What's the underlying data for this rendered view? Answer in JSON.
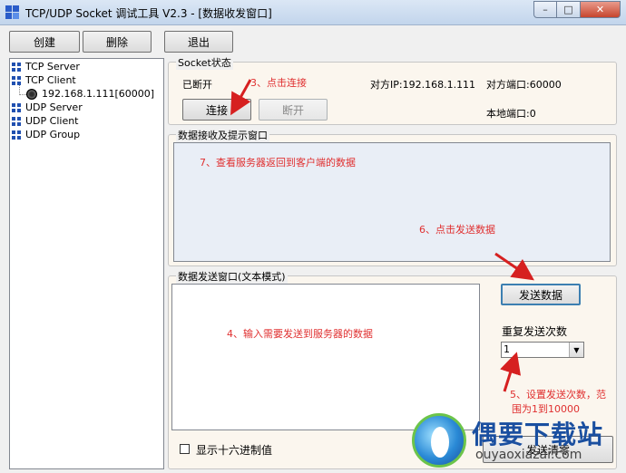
{
  "window": {
    "title": "TCP/UDP Socket 调试工具 V2.3 - [数据收发窗口]",
    "minimize": "–",
    "maximize": "□",
    "close": "✕"
  },
  "toolbar": {
    "create": "创建",
    "delete": "删除",
    "exit": "退出"
  },
  "tree": {
    "tcp_server": "TCP Server",
    "tcp_client": "TCP Client",
    "connection": "192.168.1.111[60000]",
    "udp_server": "UDP Server",
    "udp_client": "UDP Client",
    "udp_group": "UDP Group"
  },
  "socket": {
    "legend": "Socket状态",
    "status": "已断开",
    "remote_ip": "对方IP:192.168.1.111",
    "remote_port": "对方端口:60000",
    "local_port": "本地端口:0",
    "connect": "连接",
    "disconnect": "断开"
  },
  "receive": {
    "legend": "数据接收及提示窗口"
  },
  "send": {
    "legend": "数据发送窗口(文本模式)",
    "send_button": "发送数据",
    "repeat_label": "重复发送次数",
    "repeat_value": "1",
    "hex_label": "显示十六进制值",
    "clear_button": "发送清零"
  },
  "annotations": {
    "step3": "3、点击连接",
    "step4": "4、输入需要发送到服务器的数据",
    "step5_line1": "5、设置发送次数，范",
    "step5_line2": "围为1到10000",
    "step6": "6、点击发送数据",
    "step7": "7、查看服务器返回到客户端的数据"
  },
  "watermark": {
    "cn": "偶要下载站",
    "en": "ouyaoxiazai.com"
  },
  "colors": {
    "annotation": "#e03030",
    "arrow": "#d62020",
    "title_bg": "#c2d5ec"
  }
}
